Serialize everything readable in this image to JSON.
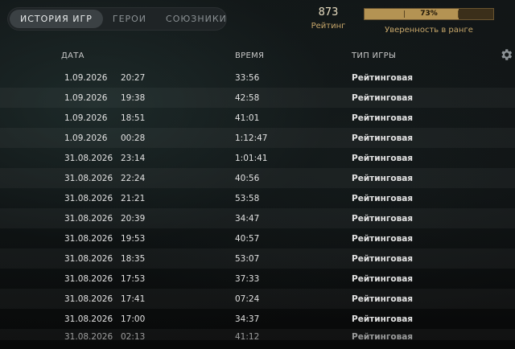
{
  "tabs": [
    {
      "label": "ИСТОРИЯ ИГР",
      "active": true
    },
    {
      "label": "ГЕРОИ",
      "active": false
    },
    {
      "label": "СОЮЗНИКИ",
      "active": false
    }
  ],
  "rating": {
    "value": "873",
    "label": "Рейтинг"
  },
  "confidence": {
    "percent": 73,
    "text": "73%",
    "label": "Уверенность в ранге"
  },
  "columns": {
    "date": "ДАТА",
    "duration": "ВРЕМЯ",
    "game_type": "ТИП ИГРЫ"
  },
  "settings_icon": "gear-icon",
  "matches": [
    {
      "date": "1.09.2026",
      "time": "20:27",
      "duration": "33:56",
      "type": "Рейтинговая"
    },
    {
      "date": "1.09.2026",
      "time": "19:38",
      "duration": "42:58",
      "type": "Рейтинговая"
    },
    {
      "date": "1.09.2026",
      "time": "18:51",
      "duration": "41:01",
      "type": "Рейтинговая"
    },
    {
      "date": "1.09.2026",
      "time": "00:28",
      "duration": "1:12:47",
      "type": "Рейтинговая"
    },
    {
      "date": "31.08.2026",
      "time": "23:14",
      "duration": "1:01:41",
      "type": "Рейтинговая"
    },
    {
      "date": "31.08.2026",
      "time": "22:24",
      "duration": "40:56",
      "type": "Рейтинговая"
    },
    {
      "date": "31.08.2026",
      "time": "21:21",
      "duration": "53:58",
      "type": "Рейтинговая"
    },
    {
      "date": "31.08.2026",
      "time": "20:39",
      "duration": "34:47",
      "type": "Рейтинговая"
    },
    {
      "date": "31.08.2026",
      "time": "19:53",
      "duration": "40:57",
      "type": "Рейтинговая"
    },
    {
      "date": "31.08.2026",
      "time": "18:35",
      "duration": "53:07",
      "type": "Рейтинговая"
    },
    {
      "date": "31.08.2026",
      "time": "17:53",
      "duration": "37:33",
      "type": "Рейтинговая"
    },
    {
      "date": "31.08.2026",
      "time": "17:41",
      "duration": "07:24",
      "type": "Рейтинговая"
    },
    {
      "date": "31.08.2026",
      "time": "17:00",
      "duration": "34:37",
      "type": "Рейтинговая"
    },
    {
      "date": "31.08.2026",
      "time": "02:13",
      "duration": "41:12",
      "type": "Рейтинговая"
    }
  ]
}
